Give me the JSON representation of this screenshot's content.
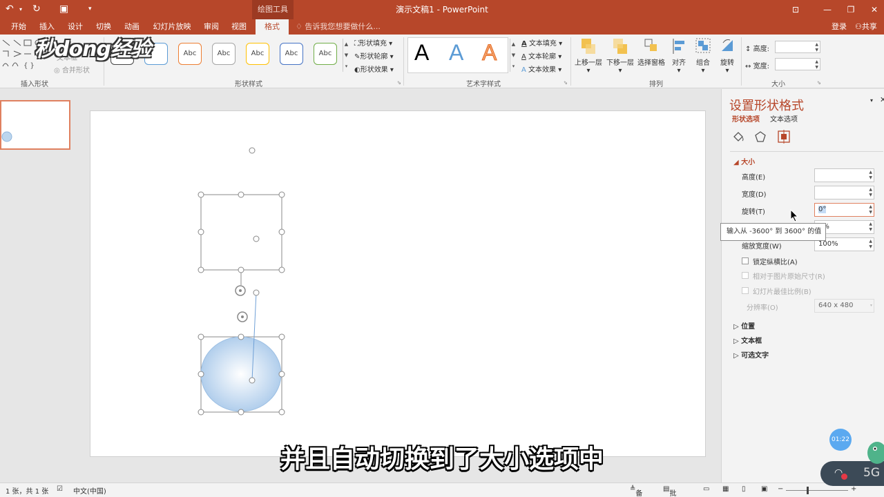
{
  "titlebar": {
    "contextual_tab_group": "绘图工具",
    "document_title": "演示文稿1 - PowerPoint"
  },
  "tabs": [
    {
      "label": "开始"
    },
    {
      "label": "插入"
    },
    {
      "label": "设计"
    },
    {
      "label": "切换"
    },
    {
      "label": "动画"
    },
    {
      "label": "幻灯片放映"
    },
    {
      "label": "审阅"
    },
    {
      "label": "视图"
    },
    {
      "label": "格式",
      "active": true
    }
  ],
  "tell_me": "告诉我您想要做什么...",
  "account": {
    "login": "登录",
    "share": "共享"
  },
  "ribbon": {
    "insert_shapes": {
      "label": "插入形状",
      "edit_text": "文本框",
      "merge": "合并形状"
    },
    "shape_styles": {
      "label": "形状样式",
      "thumb_text": "Abc",
      "fill": "形状填充",
      "outline": "形状轮廓",
      "effects": "形状效果"
    },
    "wordart": {
      "label": "艺术字样式",
      "letter": "A",
      "text_fill": "文本填充",
      "text_outline": "文本轮廓",
      "text_effects": "文本效果"
    },
    "arrange": {
      "label": "排列",
      "bring_forward": "上移一层",
      "send_backward": "下移一层",
      "selection_pane": "选择窗格",
      "align": "对齐",
      "group": "组合",
      "rotate": "旋转"
    },
    "size": {
      "label": "大小",
      "height": "高度:",
      "width": "宽度:"
    }
  },
  "format_pane": {
    "title": "设置形状格式",
    "tab_shape": "形状选项",
    "tab_text": "文本选项",
    "section_size": "大小",
    "height_label": "高度(E)",
    "width_label": "宽度(D)",
    "rotation_label": "旋转(T)",
    "rotation_value": "0°",
    "scale_height_value": "8%",
    "scale_width_label": "缩放宽度(W)",
    "scale_width_value": "100%",
    "lock_aspect": "锁定纵横比(A)",
    "relative_original": "相对于图片原始尺寸(R)",
    "best_scale": "幻灯片最佳比例(B)",
    "resolution_label": "分辨率(O)",
    "resolution_value": "640 x 480",
    "section_position": "位置",
    "section_textbox": "文本框",
    "section_alt_text": "可选文字"
  },
  "tooltip": "输入从 -3600° 到 3600° 的值",
  "statusbar": {
    "slide_info": "1 张，共 1 张",
    "language": "中文(中国)",
    "notes": "备注",
    "comments": "批注"
  },
  "overlay": {
    "watermark": "秒dong经验",
    "subtitle": "并且自动切换到了大小选项中",
    "timer": "01:22",
    "network": "5G"
  },
  "colors": {
    "accent": "#b7472a",
    "circle_fill": "#bcd6ee",
    "selection": "#8a8a8a"
  }
}
